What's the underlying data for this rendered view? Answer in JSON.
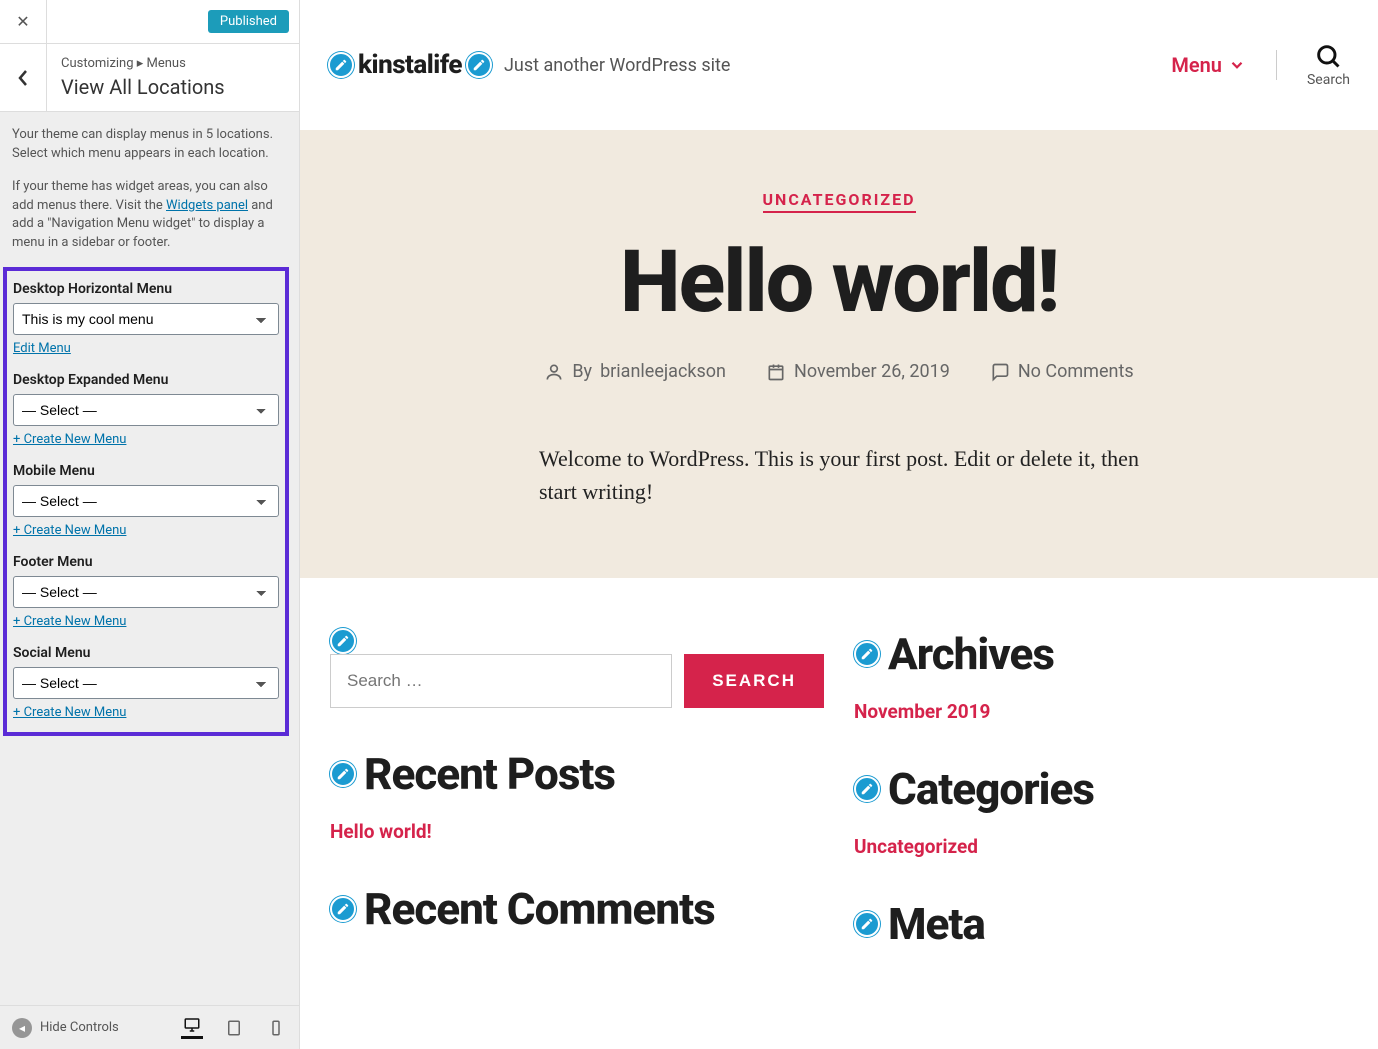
{
  "sidebar": {
    "published_label": "Published",
    "crumb": "Customizing ▸ Menus",
    "title": "View All Locations",
    "desc1": "Your theme can display menus in 5 locations. Select which menu appears in each location.",
    "desc2a": "If your theme has widget areas, you can also add menus there. Visit the ",
    "widgets_link": "Widgets panel",
    "desc2b": " and add a \"Navigation Menu widget\" to display a menu in a sidebar or footer.",
    "locations": [
      {
        "label": "Desktop Horizontal Menu",
        "value": "This is my cool menu",
        "action": "Edit Menu"
      },
      {
        "label": "Desktop Expanded Menu",
        "value": "— Select —",
        "action": "+ Create New Menu"
      },
      {
        "label": "Mobile Menu",
        "value": "— Select —",
        "action": "+ Create New Menu"
      },
      {
        "label": "Footer Menu",
        "value": "— Select —",
        "action": "+ Create New Menu"
      },
      {
        "label": "Social Menu",
        "value": "— Select —",
        "action": "+ Create New Menu"
      }
    ],
    "hide_controls": "Hide Controls"
  },
  "preview": {
    "brand": "kinstalife",
    "tagline": "Just another WordPress site",
    "menu_label": "Menu",
    "search_label": "Search",
    "category": "UNCATEGORIZED",
    "title": "Hello world!",
    "by_label": "By",
    "author": "brianleejackson",
    "date": "November 26, 2019",
    "comments": "No Comments",
    "body": "Welcome to WordPress. This is your first post. Edit or delete it, then start writing!",
    "search_placeholder": "Search …",
    "search_button": "SEARCH",
    "recent_posts_title": "Recent Posts",
    "recent_post_link": "Hello world!",
    "recent_comments_title": "Recent Comments",
    "archives_title": "Archives",
    "archive_link": "November 2019",
    "categories_title": "Categories",
    "category_link": "Uncategorized",
    "meta_title": "Meta"
  }
}
